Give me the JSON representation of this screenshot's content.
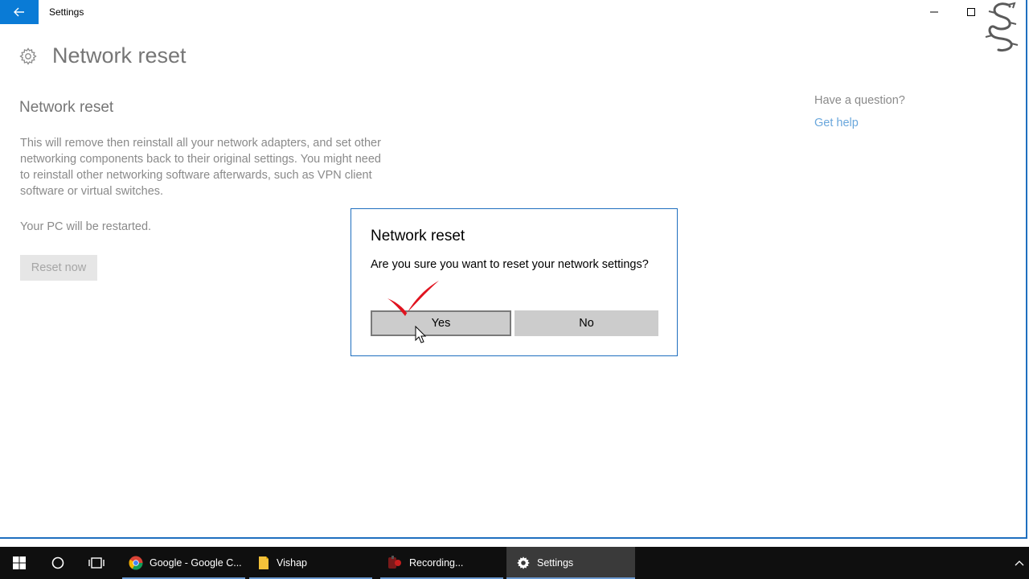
{
  "window": {
    "title": "Settings"
  },
  "page": {
    "title": "Network reset",
    "section_title": "Network reset",
    "description": "This will remove then reinstall all your network adapters, and set other networking components back to their original settings. You might need to reinstall other networking software afterwards, such as VPN client software or virtual switches.",
    "restart_note": "Your PC will be restarted.",
    "reset_button": "Reset now"
  },
  "help": {
    "question": "Have a question?",
    "link": "Get help"
  },
  "dialog": {
    "title": "Network reset",
    "message": "Are you sure you want to reset your network settings?",
    "yes_label": "Yes",
    "no_label": "No"
  },
  "taskbar": {
    "apps": [
      {
        "label": "Google - Google C...",
        "icon": "chrome-icon"
      },
      {
        "label": "Vishap",
        "icon": "folder-icon"
      },
      {
        "label": "Recording...",
        "icon": "recording-icon"
      },
      {
        "label": "Settings",
        "icon": "gear-icon",
        "active": true
      }
    ]
  },
  "colors": {
    "accent": "#0a7bd6",
    "link": "#6aa7dc",
    "taskbar": "#0f0f0f",
    "checkmark": "#e0131f"
  }
}
